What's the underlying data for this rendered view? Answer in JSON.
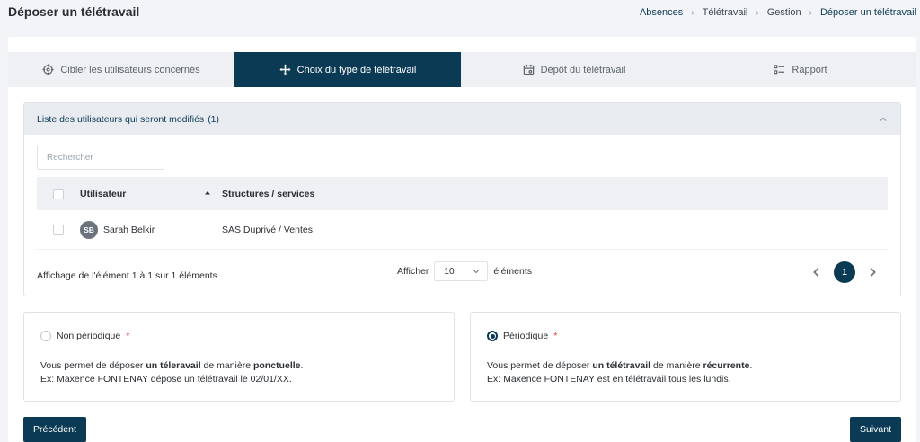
{
  "header": {
    "title": "Déposer un télétravail",
    "breadcrumb": [
      "Absences",
      "Télétravail",
      "Gestion",
      "Déposer un télétravail"
    ]
  },
  "stepper": {
    "steps": [
      {
        "label": "Cibler les utilisateurs concernés",
        "icon": "crosshair-icon",
        "active": false
      },
      {
        "label": "Choix du type de télétravail",
        "icon": "move-arrows-icon",
        "active": true
      },
      {
        "label": "Dépôt du télétravail",
        "icon": "calendar-icon",
        "active": false
      },
      {
        "label": "Rapport",
        "icon": "list-check-icon",
        "active": false
      }
    ]
  },
  "users_panel": {
    "title": "Liste des utilisateurs qui seront modifiés",
    "count": "(1)",
    "search_placeholder": "Rechercher",
    "columns": {
      "user": "Utilisateur",
      "structure": "Structures / services"
    },
    "rows": [
      {
        "initials": "SB",
        "name": "Sarah Belkir",
        "structure": "SAS Duprivé / Ventes"
      }
    ],
    "footer": {
      "info": "Affichage de l'élément 1 à 1 sur 1 éléments",
      "show_label": "Afficher",
      "page_size": "10",
      "elements_label": "éléments",
      "current_page": "1"
    }
  },
  "options": {
    "non_periodic": {
      "label": "Non périodique",
      "required_mark": "*",
      "desc_1": "Vous permet de déposer ",
      "desc_bold_1": "un téleravail",
      "desc_2": " de manière ",
      "desc_bold_2": "ponctuelle",
      "desc_3": ".",
      "example": "Ex: Maxence FONTENAY dépose un télétravail le 02/01/XX.",
      "selected": false
    },
    "periodic": {
      "label": "Périodique",
      "required_mark": "*",
      "desc_1": "Vous permet de déposer ",
      "desc_bold_1": "un télétravail",
      "desc_2": " de manière ",
      "desc_bold_2": "récurrente",
      "desc_3": ".",
      "example": "Ex: Maxence FONTENAY est en télétravail tous les lundis.",
      "selected": true
    }
  },
  "actions": {
    "prev_label": "Précédent",
    "next_label": "Suivant"
  },
  "colors": {
    "primary": "#0b3a55",
    "required": "#d9423b"
  }
}
